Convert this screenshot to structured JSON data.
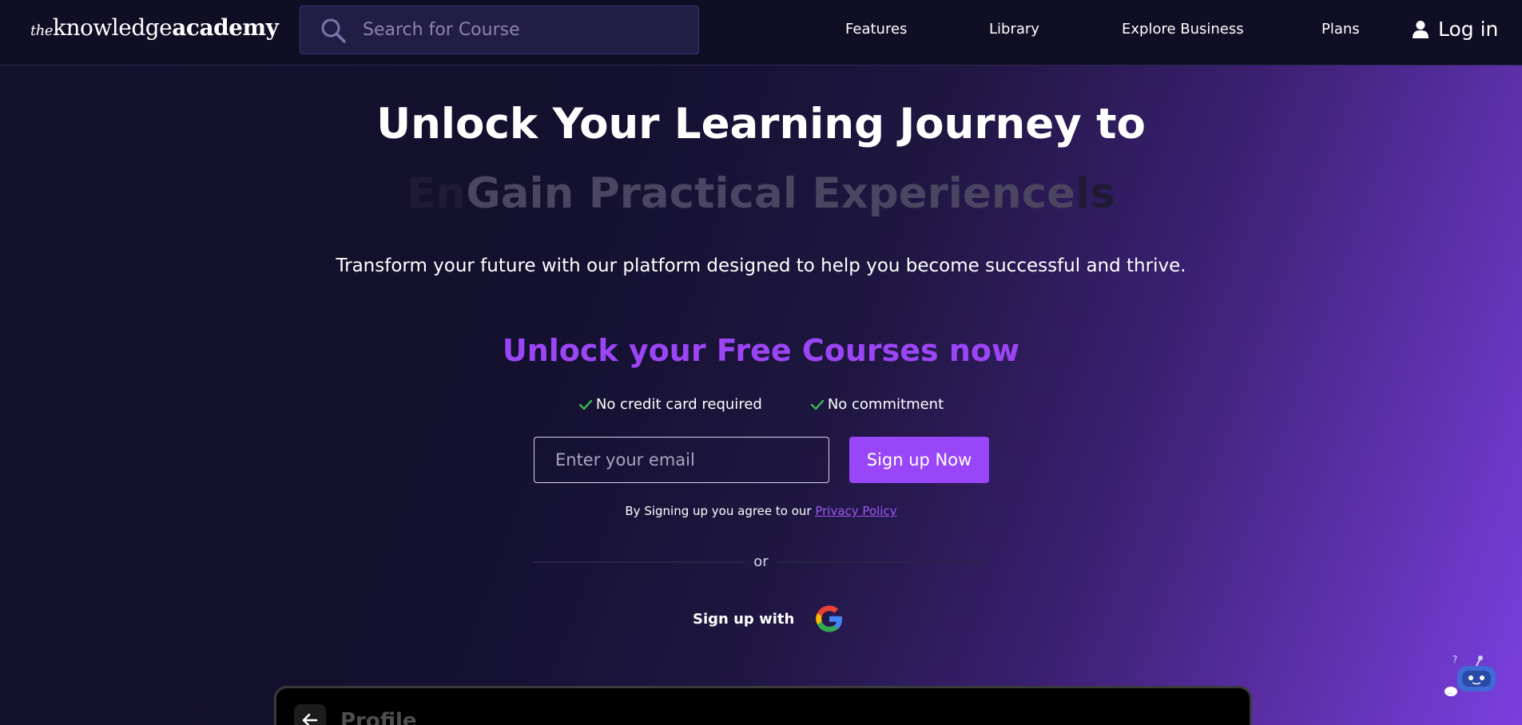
{
  "header": {
    "logo": {
      "the": "the",
      "knowledge": "knowledge",
      "academy": "academy"
    },
    "search_placeholder": "Search for Course",
    "nav": [
      "Features",
      "Library",
      "Explore Business",
      "Plans"
    ],
    "login_label": "Log in"
  },
  "hero": {
    "title": "Unlock Your Learning Journey to",
    "rotating_text": "Gain Practical Experience",
    "ghost_left": "En",
    "ghost_right": "ls",
    "subtitle": "Transform your future with our platform designed to help you become successful and thrive."
  },
  "signup": {
    "title": "Unlock your Free Courses now",
    "perks": [
      "No credit card required",
      "No commitment"
    ],
    "email_placeholder": "Enter your email",
    "button_label": "Sign up Now",
    "agree_text": "By Signing up you agree to our ",
    "privacy_link": "Privacy Policy",
    "or_label": "or",
    "social_label": "Sign up with"
  },
  "preview": {
    "profile_label": "Profile"
  },
  "colors": {
    "accent": "#9846f7",
    "check": "#3cc45a",
    "header_bg": "#100e24"
  }
}
